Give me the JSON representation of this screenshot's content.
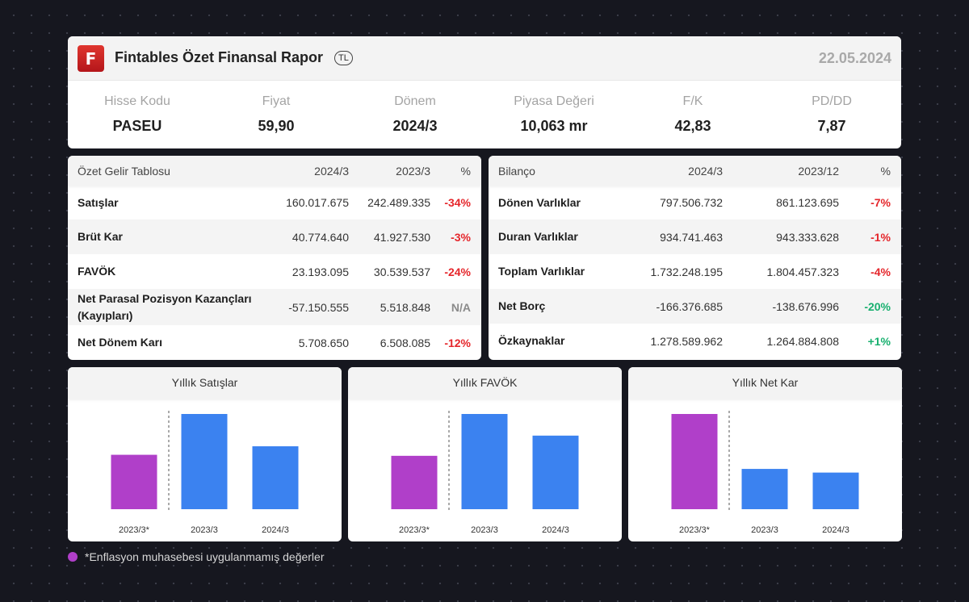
{
  "header": {
    "logo_letter": "F",
    "title": "Fintables Özet Finansal Rapor",
    "currency": "TL",
    "date": "22.05.2024"
  },
  "metrics": [
    {
      "label": "Hisse Kodu",
      "value": "PASEU"
    },
    {
      "label": "Fiyat",
      "value": "59,90"
    },
    {
      "label": "Dönem",
      "value": "2024/3"
    },
    {
      "label": "Piyasa Değeri",
      "value": "10,063 mr"
    },
    {
      "label": "F/K",
      "value": "42,83"
    },
    {
      "label": "PD/DD",
      "value": "7,87"
    }
  ],
  "income": {
    "headers": [
      "Özet Gelir Tablosu",
      "2024/3",
      "2023/3",
      "%"
    ],
    "rows": [
      {
        "label": "Satışlar",
        "a": "160.017.675",
        "b": "242.489.335",
        "pct": "-34%"
      },
      {
        "label": "Brüt Kar",
        "a": "40.774.640",
        "b": "41.927.530",
        "pct": "-3%"
      },
      {
        "label": "FAVÖK",
        "a": "23.193.095",
        "b": "30.539.537",
        "pct": "-24%"
      },
      {
        "label": "Net Parasal Pozisyon Kazançları (Kayıpları)",
        "a": "-57.150.555",
        "b": "5.518.848",
        "pct": "N/A"
      },
      {
        "label": "Net Dönem Karı",
        "a": "5.708.650",
        "b": "6.508.085",
        "pct": "-12%"
      }
    ]
  },
  "balance": {
    "headers": [
      "Bilanço",
      "2024/3",
      "2023/12",
      "%"
    ],
    "rows": [
      {
        "label": "Dönen Varlıklar",
        "a": "797.506.732",
        "b": "861.123.695",
        "pct": "-7%"
      },
      {
        "label": "Duran Varlıklar",
        "a": "934.741.463",
        "b": "943.333.628",
        "pct": "-1%"
      },
      {
        "label": "Toplam Varlıklar",
        "a": "1.732.248.195",
        "b": "1.804.457.323",
        "pct": "-4%"
      },
      {
        "label": "Net Borç",
        "a": "-166.376.685",
        "b": "-138.676.996",
        "pct": "-20%"
      },
      {
        "label": "Özkaynaklar",
        "a": "1.278.589.962",
        "b": "1.264.884.808",
        "pct": "+1%"
      }
    ]
  },
  "colors": {
    "inflation_unadjusted": "#b03fc9",
    "bar": "#3b82f0",
    "negative": "#e5262b",
    "positive": "#18b06f"
  },
  "chart_data": [
    {
      "type": "bar",
      "title": "Yıllık Satışlar",
      "categories": [
        "2023/3*",
        "2023/3",
        "2024/3"
      ],
      "values": [
        160,
        280,
        185
      ]
    },
    {
      "type": "bar",
      "title": "Yıllık FAVÖK",
      "categories": [
        "2023/3*",
        "2023/3",
        "2024/3"
      ],
      "values": [
        18.5,
        33,
        25.5
      ]
    },
    {
      "type": "bar",
      "title": "Yıllık Net Kar",
      "categories": [
        "2023/3*",
        "2023/3",
        "2024/3"
      ],
      "values": [
        13,
        5.5,
        5
      ]
    }
  ],
  "footnote": "*Enflasyon muhasebesi uygulanmamış değerler"
}
